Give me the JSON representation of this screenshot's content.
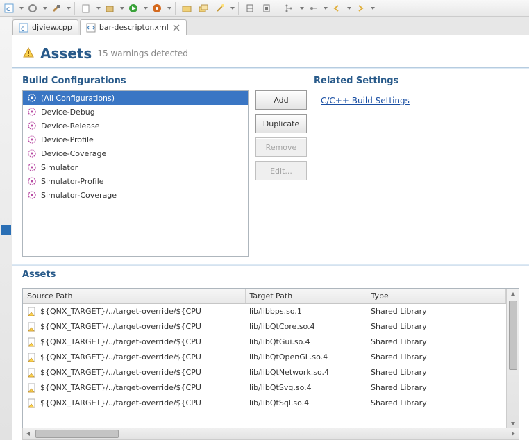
{
  "tabs": [
    {
      "label": "djview.cpp",
      "icon": "c-file-icon",
      "active": false
    },
    {
      "label": "bar-descriptor.xml",
      "icon": "xml-file-icon",
      "active": true
    }
  ],
  "page": {
    "title": "Assets",
    "warning_text": "15 warnings detected"
  },
  "build_configurations": {
    "heading": "Build Configurations",
    "items": [
      {
        "label": "(All Configurations)",
        "selected": true
      },
      {
        "label": "Device-Debug",
        "selected": false
      },
      {
        "label": "Device-Release",
        "selected": false
      },
      {
        "label": "Device-Profile",
        "selected": false
      },
      {
        "label": "Device-Coverage",
        "selected": false
      },
      {
        "label": "Simulator",
        "selected": false
      },
      {
        "label": "Simulator-Profile",
        "selected": false
      },
      {
        "label": "Simulator-Coverage",
        "selected": false
      }
    ],
    "buttons": {
      "add": "Add",
      "duplicate": "Duplicate",
      "remove": "Remove",
      "edit": "Edit..."
    }
  },
  "related_settings": {
    "heading": "Related Settings",
    "link_label": "C/C++ Build Settings"
  },
  "assets": {
    "heading": "Assets",
    "columns": {
      "source": "Source Path",
      "target": "Target Path",
      "type": "Type"
    },
    "rows": [
      {
        "source": "${QNX_TARGET}/../target-override/${CPU",
        "target": "lib/libbps.so.1",
        "type": "Shared Library"
      },
      {
        "source": "${QNX_TARGET}/../target-override/${CPU",
        "target": "lib/libQtCore.so.4",
        "type": "Shared Library"
      },
      {
        "source": "${QNX_TARGET}/../target-override/${CPU",
        "target": "lib/libQtGui.so.4",
        "type": "Shared Library"
      },
      {
        "source": "${QNX_TARGET}/../target-override/${CPU",
        "target": "lib/libQtOpenGL.so.4",
        "type": "Shared Library"
      },
      {
        "source": "${QNX_TARGET}/../target-override/${CPU",
        "target": "lib/libQtNetwork.so.4",
        "type": "Shared Library"
      },
      {
        "source": "${QNX_TARGET}/../target-override/${CPU",
        "target": "lib/libQtSvg.so.4",
        "type": "Shared Library"
      },
      {
        "source": "${QNX_TARGET}/../target-override/${CPU",
        "target": "lib/libQtSql.so.4",
        "type": "Shared Library"
      }
    ]
  }
}
